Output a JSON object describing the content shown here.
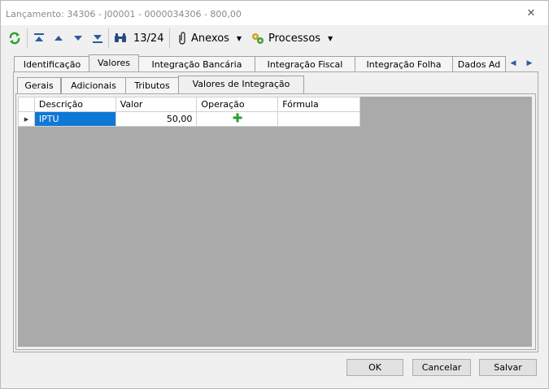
{
  "window": {
    "title": "Lançamento: 34306 - J00001 - 0000034306 - 800,00"
  },
  "toolbar": {
    "record_position": "13/24",
    "anexos_label": "Anexos",
    "processos_label": "Processos"
  },
  "main_tabs": [
    {
      "label": "Identificação"
    },
    {
      "label": "Valores"
    },
    {
      "label": "Integração Bancária"
    },
    {
      "label": "Integração Fiscal"
    },
    {
      "label": "Integração Folha"
    },
    {
      "label": "Dados Ad"
    }
  ],
  "active_main_tab": "Valores",
  "sub_tabs": [
    {
      "label": "Gerais"
    },
    {
      "label": "Adicionais"
    },
    {
      "label": "Tributos"
    },
    {
      "label": "Valores de Integração"
    }
  ],
  "active_sub_tab": "Valores de Integração",
  "grid": {
    "columns": [
      "Descrição",
      "Valor",
      "Operação",
      "Fórmula"
    ],
    "rows": [
      {
        "descricao": "IPTU",
        "valor": "50,00",
        "operacao_icon": "plus-icon",
        "formula": ""
      }
    ]
  },
  "buttons": {
    "ok": "OK",
    "cancel": "Cancelar",
    "save": "Salvar"
  },
  "colors": {
    "selection": "#0f78d7",
    "grid_background": "#aaaaaa",
    "plus": "#2e9e2e"
  }
}
